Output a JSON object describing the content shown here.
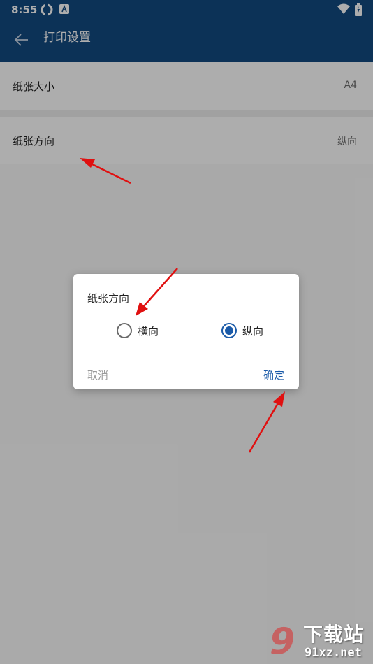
{
  "status_bar": {
    "time": "8:55",
    "icons": [
      "sync-icon",
      "app-notification-icon",
      "wifi-icon",
      "battery-charging-icon"
    ]
  },
  "app_bar": {
    "title": "打印设置",
    "back_icon": "arrow-left-icon",
    "background_color": "#134a80"
  },
  "settings": {
    "paper_size": {
      "label": "纸张大小",
      "value": "A4"
    },
    "paper_orientation": {
      "label": "纸张方向",
      "value": "纵向"
    }
  },
  "dialog": {
    "title": "纸张方向",
    "options": [
      {
        "label": "横向",
        "checked": false
      },
      {
        "label": "纵向",
        "checked": true
      }
    ],
    "cancel_label": "取消",
    "ok_label": "确定",
    "accent_color": "#1a5aa8"
  },
  "annotation_color": "#e01010",
  "watermark": {
    "logo": "9",
    "text": "下载站",
    "url": "91xz.net"
  }
}
